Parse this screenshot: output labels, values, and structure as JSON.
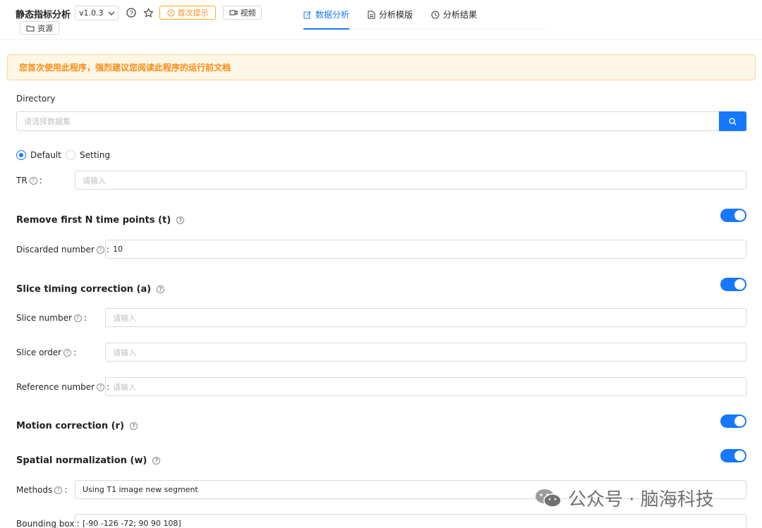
{
  "header": {
    "app_title": "静态指标分析",
    "version": "v1.0.3",
    "hint_label": "首次提示",
    "video_label": "视频",
    "resource_label": "资源"
  },
  "tabs": [
    {
      "label": "数据分析",
      "icon": "edit-icon",
      "active": true
    },
    {
      "label": "分析模版",
      "icon": "file-icon",
      "active": false
    },
    {
      "label": "分析结果",
      "icon": "history-icon",
      "active": false
    }
  ],
  "alert": {
    "text": "您首次使用此程序，强烈建议您阅读此程序的运行前文档"
  },
  "form": {
    "directory_label": "Directory",
    "directory_placeholder": "请选择数据集",
    "radio_default": "Default",
    "radio_setting": "Setting",
    "tr_label": "TR",
    "tr_placeholder": "请输入",
    "sections": {
      "remove": "Remove first N time points (t)",
      "slice": "Slice timing correction (a)",
      "motion": "Motion correction (r)",
      "spatial": "Spatial normalization (w)"
    },
    "discarded_label": "Discarded number",
    "discarded_value": "10",
    "slice_number_label": "Slice number",
    "slice_order_label": "Slice order",
    "reference_label": "Reference number",
    "placeholder": "请输入",
    "methods_label": "Methods",
    "methods_value": "Using T1 image new segment",
    "bbox_label": "Bounding box",
    "bbox_value": "[-90 -126 -72; 90 90 108]"
  },
  "watermark": "公众号 · 脑海科技",
  "colors": {
    "accent": "#1677ff",
    "warning": "#fa8c16"
  }
}
